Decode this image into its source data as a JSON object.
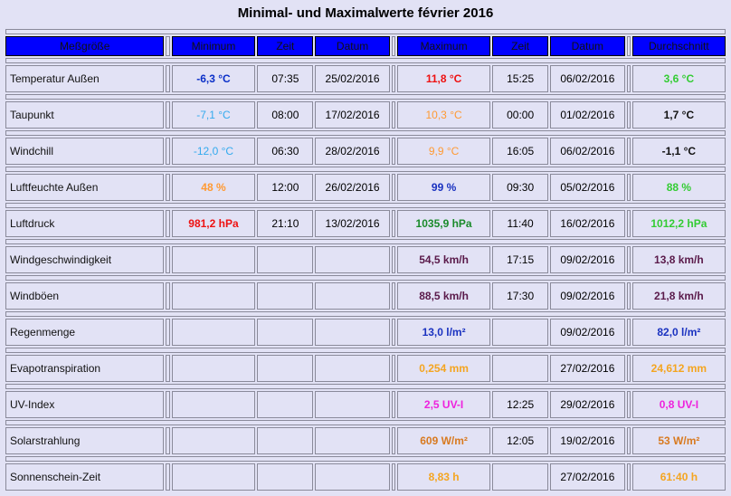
{
  "title": "Minimal- und Maximalwerte février 2016",
  "headers": {
    "label": "Meßgröße",
    "min": "Minimum",
    "min_time": "Zeit",
    "min_date": "Datum",
    "max": "Maximum",
    "max_time": "Zeit",
    "max_date": "Datum",
    "avg": "Durchschnitt"
  },
  "rows": [
    {
      "label": "Temperatur Außen",
      "min": "-6,3 °C",
      "min_time": "07:35",
      "min_date": "25/02/2016",
      "max": "11,8 °C",
      "max_time": "15:25",
      "max_date": "06/02/2016",
      "avg": "3,6 °C"
    },
    {
      "label": "Taupunkt",
      "min": "-7,1 °C",
      "min_time": "08:00",
      "min_date": "17/02/2016",
      "max": "10,3 °C",
      "max_time": "00:00",
      "max_date": "01/02/2016",
      "avg": "1,7 °C"
    },
    {
      "label": "Windchill",
      "min": "-12,0 °C",
      "min_time": "06:30",
      "min_date": "28/02/2016",
      "max": "9,9 °C",
      "max_time": "16:05",
      "max_date": "06/02/2016",
      "avg": "-1,1 °C"
    },
    {
      "label": "Luftfeuchte Außen",
      "min": "48 %",
      "min_time": "12:00",
      "min_date": "26/02/2016",
      "max": "99 %",
      "max_time": "09:30",
      "max_date": "05/02/2016",
      "avg": "88 %"
    },
    {
      "label": "Luftdruck",
      "min": "981,2 hPa",
      "min_time": "21:10",
      "min_date": "13/02/2016",
      "max": "1035,9 hPa",
      "max_time": "11:40",
      "max_date": "16/02/2016",
      "avg": "1012,2 hPa"
    },
    {
      "label": "Windgeschwindigkeit",
      "min": "",
      "min_time": "",
      "min_date": "",
      "max": "54,5 km/h",
      "max_time": "17:15",
      "max_date": "09/02/2016",
      "avg": "13,8 km/h"
    },
    {
      "label": "Windböen",
      "min": "",
      "min_time": "",
      "min_date": "",
      "max": "88,5 km/h",
      "max_time": "17:30",
      "max_date": "09/02/2016",
      "avg": "21,8 km/h"
    },
    {
      "label": "Regenmenge",
      "min": "",
      "min_time": "",
      "min_date": "",
      "max": "13,0 l/m²",
      "max_time": "",
      "max_date": "09/02/2016",
      "avg": "82,0 l/m²"
    },
    {
      "label": "Evapotranspiration",
      "min": "",
      "min_time": "",
      "min_date": "",
      "max": "0,254 mm",
      "max_time": "",
      "max_date": "27/02/2016",
      "avg": "24,612 mm"
    },
    {
      "label": "UV-Index",
      "min": "",
      "min_time": "",
      "min_date": "",
      "max": "2,5 UV-I",
      "max_time": "12:25",
      "max_date": "29/02/2016",
      "avg": "0,8 UV-I"
    },
    {
      "label": "Solarstrahlung",
      "min": "",
      "min_time": "",
      "min_date": "",
      "max": "609 W/m²",
      "max_time": "12:05",
      "max_date": "19/02/2016",
      "avg": "53 W/m²"
    },
    {
      "label": "Sonnenschein-Zeit",
      "min": "",
      "min_time": "",
      "min_date": "",
      "max": "8,83 h",
      "max_time": "",
      "max_date": "27/02/2016",
      "avg": "61:40 h"
    }
  ],
  "colors": {
    "header_bg": "#0000ff",
    "page_bg": "#e2e2f5"
  }
}
